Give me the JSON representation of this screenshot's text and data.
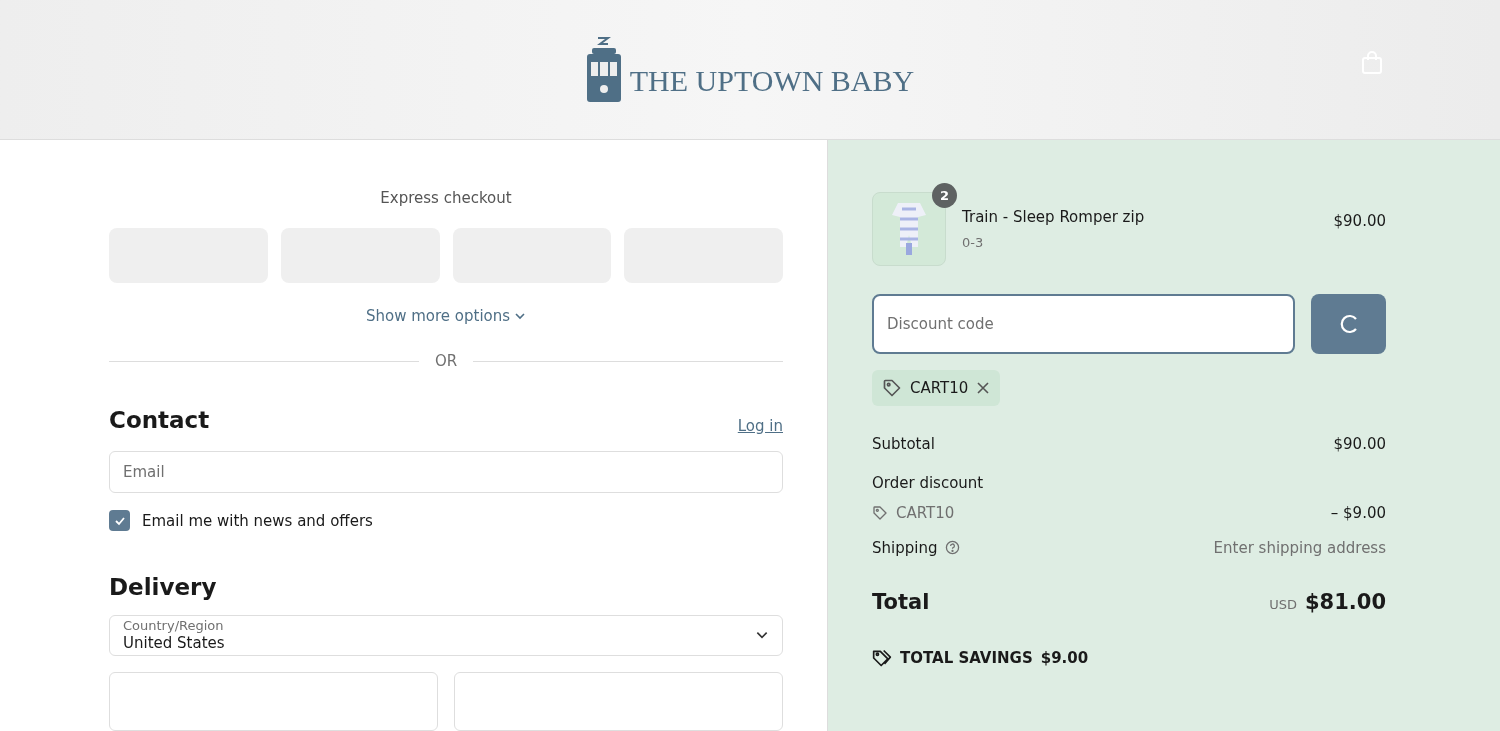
{
  "header": {
    "brand": "THE UPTOWN BABY"
  },
  "express": {
    "title": "Express checkout",
    "more": "Show more options",
    "divider": "OR"
  },
  "contact": {
    "title": "Contact",
    "login": "Log in",
    "email_placeholder": "Email",
    "newsletter": {
      "label": "Email me with news and offers",
      "checked": true
    }
  },
  "delivery": {
    "title": "Delivery",
    "country": {
      "label": "Country/Region",
      "value": "United States"
    }
  },
  "summary": {
    "item": {
      "quantity": "2",
      "name": "Train - Sleep Romper zip",
      "variant": "0-3",
      "price": "$90.00"
    },
    "discount_placeholder": "Discount code",
    "applied_code": "CART10",
    "subtotal": {
      "label": "Subtotal",
      "value": "$90.00"
    },
    "order_discount": {
      "label": "Order discount",
      "code": "CART10",
      "value": "– $9.00"
    },
    "shipping": {
      "label": "Shipping",
      "value": "Enter shipping address"
    },
    "total": {
      "label": "Total",
      "currency": "USD",
      "value": "$81.00"
    },
    "savings": {
      "label": "TOTAL SAVINGS",
      "value": "$9.00"
    }
  }
}
